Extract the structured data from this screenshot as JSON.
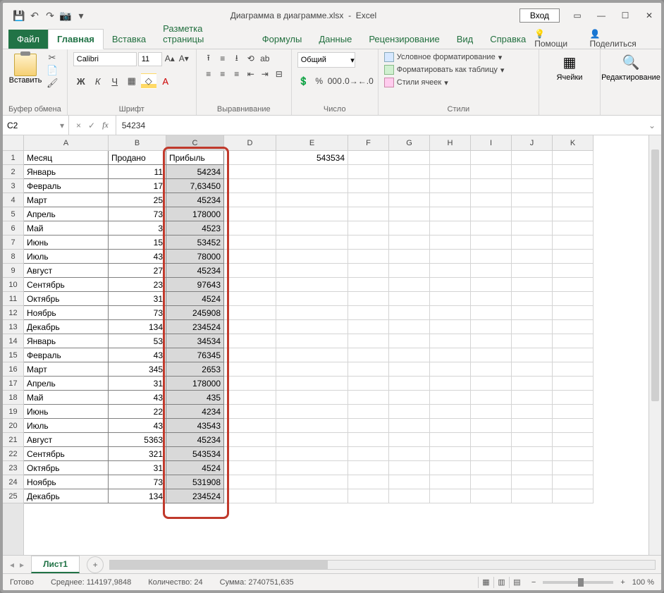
{
  "title": {
    "doc": "Диаграмма в диаграмме.xlsx",
    "app": "Excel"
  },
  "login": "Вход",
  "tabs": {
    "file": "Файл",
    "home": "Главная",
    "insert": "Вставка",
    "layout": "Разметка страницы",
    "formulas": "Формулы",
    "data": "Данные",
    "review": "Рецензирование",
    "view": "Вид",
    "help": "Справка",
    "tellme": "Помощи",
    "share": "Поделиться"
  },
  "ribbon": {
    "paste": "Вставить",
    "clipboard": "Буфер обмена",
    "font_name": "Calibri",
    "font_size": "11",
    "font_group": "Шрифт",
    "align_group": "Выравнивание",
    "number_format": "Общий",
    "number_group": "Число",
    "cond_fmt": "Условное форматирование",
    "as_table": "Форматировать как таблицу",
    "cell_styles": "Стили ячеек",
    "styles_group": "Стили",
    "cells": "Ячейки",
    "editing": "Редактирование"
  },
  "namebox": "C2",
  "formula": "54234",
  "col_letters": [
    "A",
    "B",
    "C",
    "D",
    "E",
    "F",
    "G",
    "H",
    "I",
    "J",
    "K"
  ],
  "headers": {
    "a": "Месяц",
    "b": "Продано",
    "c": "Прибыль"
  },
  "e1": "543534",
  "rows": [
    {
      "n": 2,
      "a": "Январь",
      "b": "11",
      "c": "54234"
    },
    {
      "n": 3,
      "a": "Февраль",
      "b": "17",
      "c": "7,63450"
    },
    {
      "n": 4,
      "a": "Март",
      "b": "25",
      "c": "45234"
    },
    {
      "n": 5,
      "a": "Апрель",
      "b": "73",
      "c": "178000"
    },
    {
      "n": 6,
      "a": "Май",
      "b": "3",
      "c": "4523"
    },
    {
      "n": 7,
      "a": "Июнь",
      "b": "15",
      "c": "53452"
    },
    {
      "n": 8,
      "a": "Июль",
      "b": "43",
      "c": "78000"
    },
    {
      "n": 9,
      "a": "Август",
      "b": "27",
      "c": "45234"
    },
    {
      "n": 10,
      "a": "Сентябрь",
      "b": "23",
      "c": "97643"
    },
    {
      "n": 11,
      "a": "Октябрь",
      "b": "31",
      "c": "4524"
    },
    {
      "n": 12,
      "a": "Ноябрь",
      "b": "73",
      "c": "245908"
    },
    {
      "n": 13,
      "a": "Декабрь",
      "b": "134",
      "c": "234524"
    },
    {
      "n": 14,
      "a": "Январь",
      "b": "53",
      "c": "34534"
    },
    {
      "n": 15,
      "a": "Февраль",
      "b": "43",
      "c": "76345"
    },
    {
      "n": 16,
      "a": "Март",
      "b": "345",
      "c": "2653"
    },
    {
      "n": 17,
      "a": "Апрель",
      "b": "31",
      "c": "178000"
    },
    {
      "n": 18,
      "a": "Май",
      "b": "43",
      "c": "435"
    },
    {
      "n": 19,
      "a": "Июнь",
      "b": "22",
      "c": "4234"
    },
    {
      "n": 20,
      "a": "Июль",
      "b": "43",
      "c": "43543"
    },
    {
      "n": 21,
      "a": "Август",
      "b": "5363",
      "c": "45234"
    },
    {
      "n": 22,
      "a": "Сентябрь",
      "b": "321",
      "c": "543534"
    },
    {
      "n": 23,
      "a": "Октябрь",
      "b": "31",
      "c": "4524"
    },
    {
      "n": 24,
      "a": "Ноябрь",
      "b": "73",
      "c": "531908"
    },
    {
      "n": 25,
      "a": "Декабрь",
      "b": "134",
      "c": "234524"
    }
  ],
  "sheet": "Лист1",
  "status": {
    "ready": "Готово",
    "avg_label": "Среднее:",
    "avg": "114197,9848",
    "count_label": "Количество:",
    "count": "24",
    "sum_label": "Сумма:",
    "sum": "2740751,635",
    "zoom": "100 %"
  }
}
